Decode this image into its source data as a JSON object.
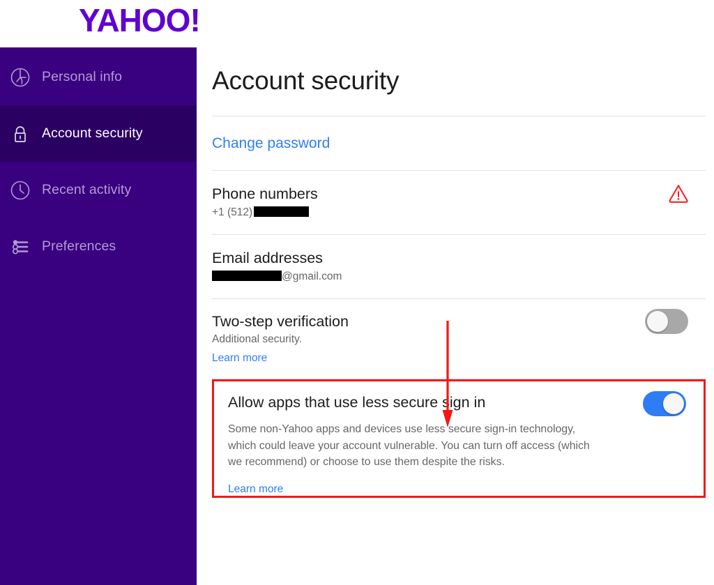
{
  "brand": {
    "name": "YAHOO!",
    "color": "#5f01d1"
  },
  "sidebar": {
    "background": "#39007f",
    "active_background": "#2b0063",
    "items": [
      {
        "label": "Personal info",
        "icon": "profile-circle-icon",
        "active": false
      },
      {
        "label": "Account security",
        "icon": "lock-icon",
        "active": true
      },
      {
        "label": "Recent activity",
        "icon": "clock-icon",
        "active": false
      },
      {
        "label": "Preferences",
        "icon": "sliders-icon",
        "active": false
      }
    ]
  },
  "main": {
    "page_title": "Account security",
    "change_password": {
      "label": "Change password"
    },
    "phone": {
      "title": "Phone numbers",
      "value_prefix": "+1 (512)",
      "value_redacted": true,
      "warning_icon": "warning-triangle-icon",
      "warning_color": "#ff2121"
    },
    "email": {
      "title": "Email addresses",
      "value_redacted": true,
      "value_suffix": "@gmail.com"
    },
    "two_step": {
      "title": "Two-step verification",
      "subtitle": "Additional security.",
      "learn_more": "Learn more",
      "toggle_state": "off"
    },
    "less_secure": {
      "title": "Allow apps that use less secure sign in",
      "body": "Some non-Yahoo apps and devices use less secure sign-in technology, which could leave your account vulnerable. You can turn off access (which we recommend) or choose to use them despite the risks.",
      "learn_more": "Learn more",
      "toggle_state": "on",
      "highlighted": true,
      "highlight_color": "#f41818"
    }
  },
  "annotation": {
    "arrow_color": "#fa1414",
    "arrow_direction": "down",
    "points_to": "Allow apps that use less secure sign in"
  },
  "colors": {
    "link_blue": "#2f7ef7",
    "toggle_on": "#2e7cf6",
    "toggle_off": "#a8a8a8",
    "text_primary": "#1c1c1c",
    "text_secondary": "#666666",
    "divider": "#e0e0e0"
  }
}
